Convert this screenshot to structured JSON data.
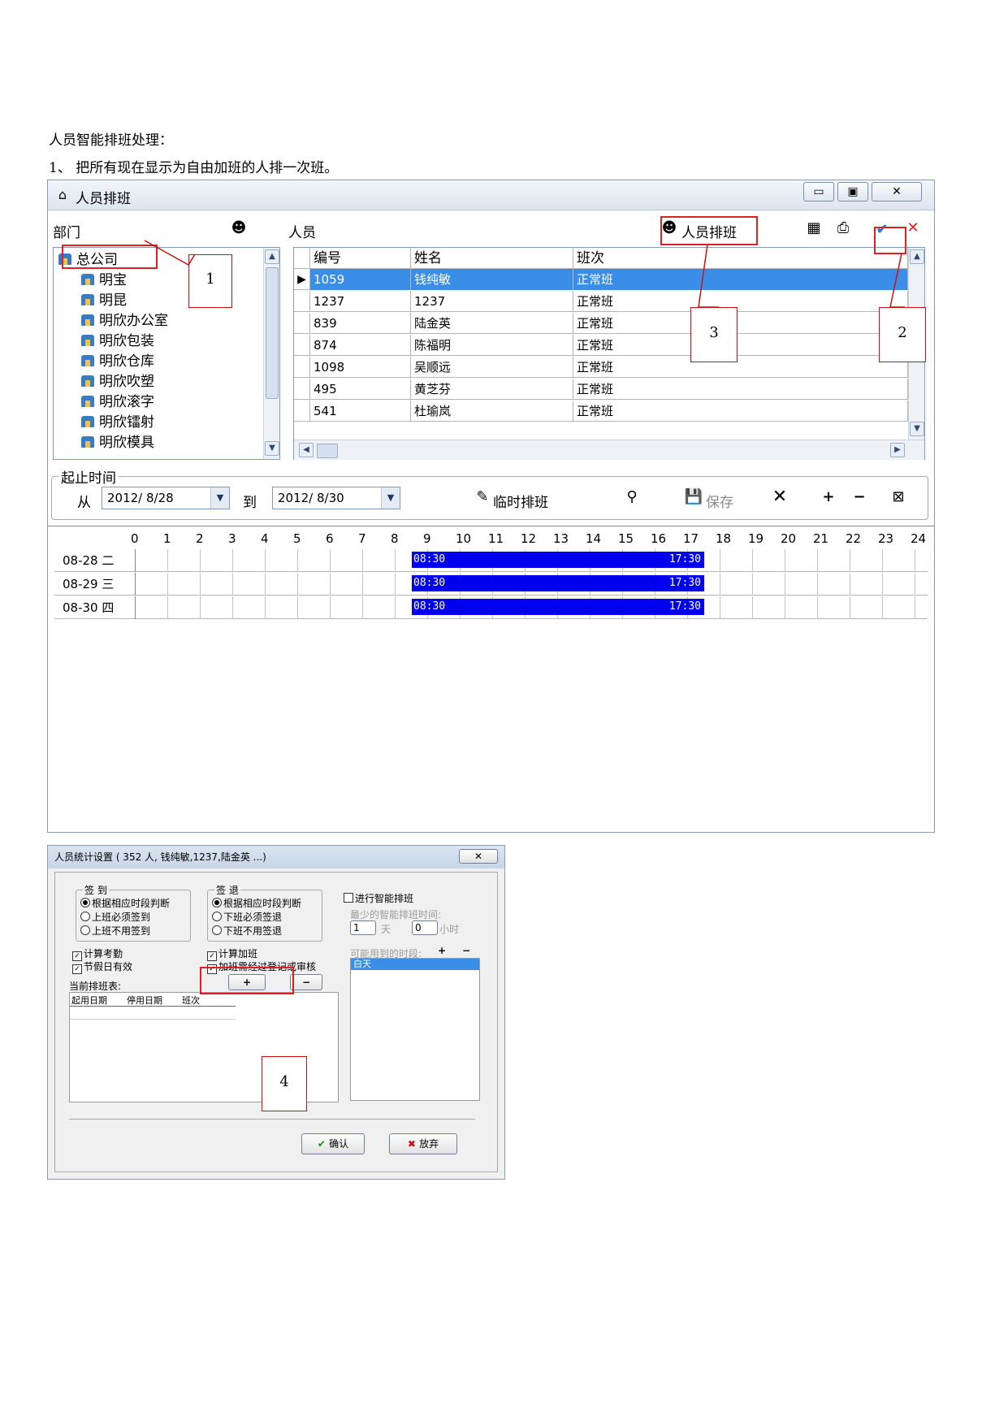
{
  "doc": {
    "heading": "人员智能排班处理：",
    "step1": "1、 把所有现在显示为自由加班的人排一次班。"
  },
  "window": {
    "title": "人员排班",
    "title_icon": "home-back-icon",
    "buttons": {
      "minimize": "▭",
      "maximize": "▣",
      "close": "✕"
    },
    "dept_label": "部门",
    "person_label": "人员",
    "schedule_btn_label": "人员排班",
    "tree": [
      "总公司",
      "明宝",
      "明昆",
      "明欣办公室",
      "明欣包装",
      "明欣仓库",
      "明欣吹塑",
      "明欣滚字",
      "明欣镭射",
      "明欣模具"
    ],
    "grid": {
      "headers": [
        "编号",
        "姓名",
        "班次"
      ],
      "rows": [
        [
          "1059",
          "钱纯敏",
          "正常班"
        ],
        [
          "1237",
          "1237",
          "正常班"
        ],
        [
          "839",
          "陆金英",
          "正常班"
        ],
        [
          "874",
          "陈福明",
          "正常班"
        ],
        [
          "1098",
          "吴顺远",
          "正常班"
        ],
        [
          "495",
          "黄芝芬",
          "正常班"
        ],
        [
          "541",
          "杜瑜岚",
          "正常班"
        ]
      ]
    },
    "period_label": "起止时间",
    "from_label": "从",
    "from_date": "2012/ 8/28",
    "to_label": "到",
    "to_date": "2012/ 8/30",
    "temp_schedule_label": "临时排班",
    "save_label": "保存",
    "hours": [
      "0",
      "1",
      "2",
      "3",
      "4",
      "5",
      "6",
      "7",
      "8",
      "9",
      "10",
      "11",
      "12",
      "13",
      "14",
      "15",
      "16",
      "17",
      "18",
      "19",
      "20",
      "21",
      "22",
      "23",
      "24"
    ],
    "timeline": [
      {
        "date": "08-28",
        "weekday": "二",
        "start": "08:30",
        "end": "17:30",
        "start_h": 8.5,
        "end_h": 17.5
      },
      {
        "date": "08-29",
        "weekday": "三",
        "start": "08:30",
        "end": "17:30",
        "start_h": 8.5,
        "end_h": 17.5
      },
      {
        "date": "08-30",
        "weekday": "四",
        "start": "08:30",
        "end": "17:30",
        "start_h": 8.5,
        "end_h": 17.5
      }
    ]
  },
  "callouts": [
    "1",
    "2",
    "3",
    "4"
  ],
  "dialog": {
    "title": "人员统计设置 ( 352 人, 钱纯敏,1237,陆金英 ...)",
    "close": "✕",
    "signin": {
      "title": "签 到",
      "options": [
        "根据相应时段判断",
        "上班必须签到",
        "上班不用签到"
      ]
    },
    "signout": {
      "title": "签 退",
      "options": [
        "根据相应时段判断",
        "下班必须签退",
        "下班不用签退"
      ]
    },
    "smart_label": "进行智能排班",
    "min_time_label": "最少的智能排班时间:",
    "days_value": "1",
    "days_unit": "天",
    "hours_value": "0",
    "hours_unit": "小时",
    "checks_left": [
      "计算考勤",
      "节假日有效"
    ],
    "checks_right": [
      "计算加班",
      "加班需经过登记或审核"
    ],
    "current_label": "当前排班表:",
    "table_headers": [
      "起用日期",
      "停用日期",
      "班次"
    ],
    "possible_label": "可能用到的时段:",
    "possible_items": [
      "白天"
    ],
    "ok_label": "确认",
    "cancel_label": "放弃"
  }
}
